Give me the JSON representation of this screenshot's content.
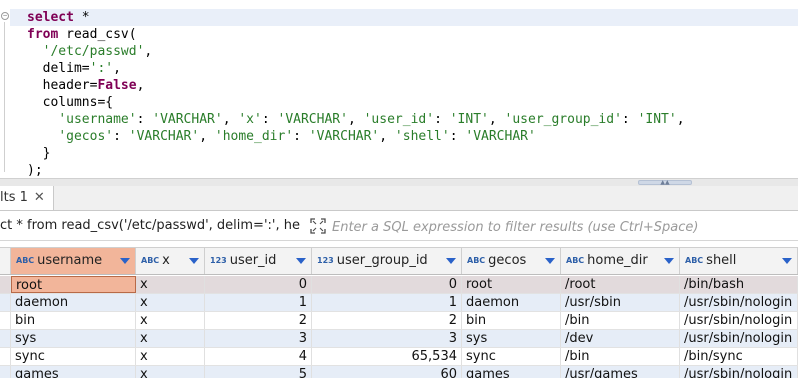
{
  "editor": {
    "lines": [
      {
        "tokens": [
          [
            "kw",
            "select"
          ],
          [
            "op",
            " *"
          ]
        ]
      },
      {
        "tokens": [
          [
            "kw",
            "from"
          ],
          [
            "op",
            " read_csv("
          ]
        ]
      },
      {
        "tokens": [
          [
            "op",
            "  "
          ],
          [
            "str",
            "'/etc/passwd'"
          ],
          [
            "op",
            ","
          ]
        ]
      },
      {
        "tokens": [
          [
            "op",
            "  delim="
          ],
          [
            "str",
            "':'"
          ],
          [
            "op",
            ","
          ]
        ]
      },
      {
        "tokens": [
          [
            "op",
            "  header="
          ],
          [
            "kw",
            "False"
          ],
          [
            "op",
            ","
          ]
        ]
      },
      {
        "tokens": [
          [
            "op",
            "  columns={"
          ]
        ]
      },
      {
        "tokens": [
          [
            "op",
            "    "
          ],
          [
            "str",
            "'username'"
          ],
          [
            "op",
            ": "
          ],
          [
            "str",
            "'VARCHAR'"
          ],
          [
            "op",
            ", "
          ],
          [
            "str",
            "'x'"
          ],
          [
            "op",
            ": "
          ],
          [
            "str",
            "'VARCHAR'"
          ],
          [
            "op",
            ", "
          ],
          [
            "str",
            "'user_id'"
          ],
          [
            "op",
            ": "
          ],
          [
            "str",
            "'INT'"
          ],
          [
            "op",
            ", "
          ],
          [
            "str",
            "'user_group_id'"
          ],
          [
            "op",
            ": "
          ],
          [
            "str",
            "'INT'"
          ],
          [
            "op",
            ","
          ]
        ]
      },
      {
        "tokens": [
          [
            "op",
            "    "
          ],
          [
            "str",
            "'gecos'"
          ],
          [
            "op",
            ": "
          ],
          [
            "str",
            "'VARCHAR'"
          ],
          [
            "op",
            ", "
          ],
          [
            "str",
            "'home_dir'"
          ],
          [
            "op",
            ": "
          ],
          [
            "str",
            "'VARCHAR'"
          ],
          [
            "op",
            ", "
          ],
          [
            "str",
            "'shell'"
          ],
          [
            "op",
            ": "
          ],
          [
            "str",
            "'VARCHAR'"
          ]
        ]
      },
      {
        "tokens": [
          [
            "op",
            "  }"
          ]
        ]
      },
      {
        "tokens": [
          [
            "op",
            ");"
          ]
        ]
      }
    ],
    "colors": {
      "keyword": "#7f0055",
      "string": "#2a7d2a",
      "current_line": "#e9eff9"
    }
  },
  "results_tab": {
    "label": "lts 1",
    "close": "✕"
  },
  "filter": {
    "query_text": "ct * from read_csv('/etc/passwd', delim=':', he",
    "placeholder": "Enter a SQL expression to filter results (use Ctrl+Space)"
  },
  "grid": {
    "columns": [
      {
        "type": "ABC",
        "name": "username",
        "align": "left"
      },
      {
        "type": "ABC",
        "name": "x",
        "align": "left"
      },
      {
        "type": "123",
        "name": "user_id",
        "align": "right"
      },
      {
        "type": "123",
        "name": "user_group_id",
        "align": "right"
      },
      {
        "type": "ABC",
        "name": "gecos",
        "align": "left"
      },
      {
        "type": "ABC",
        "name": "home_dir",
        "align": "left"
      },
      {
        "type": "ABC",
        "name": "shell",
        "align": "left"
      }
    ],
    "rows": [
      [
        "root",
        "x",
        "0",
        "0",
        "root",
        "/root",
        "/bin/bash"
      ],
      [
        "daemon",
        "x",
        "1",
        "1",
        "daemon",
        "/usr/sbin",
        "/usr/sbin/nologin"
      ],
      [
        "bin",
        "x",
        "2",
        "2",
        "bin",
        "/bin",
        "/usr/sbin/nologin"
      ],
      [
        "sys",
        "x",
        "3",
        "3",
        "sys",
        "/dev",
        "/usr/sbin/nologin"
      ],
      [
        "sync",
        "x",
        "4",
        "65,534",
        "sync",
        "/bin",
        "/bin/sync"
      ],
      [
        "games",
        "x",
        "5",
        "60",
        "games",
        "/usr/games",
        "/usr/sbin/nologin"
      ]
    ],
    "selected_row": 0,
    "accent_color": "#f2b59a"
  }
}
